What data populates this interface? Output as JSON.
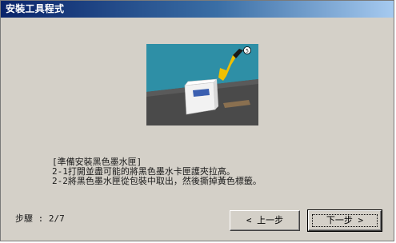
{
  "window": {
    "title": "安裝工具程式"
  },
  "illustration": {
    "icon": "ink-cartridge-illustration",
    "tape_badge": "5"
  },
  "instructions": {
    "lines": [
      "[準備安裝黑色墨水匣]",
      "2-1打開並盡可能的將黑色墨水卡匣護夾拉高。",
      "2-2將黑色墨水匣從包裝中取出，然後撕掉黃色標籤。"
    ]
  },
  "footer": {
    "step_label": "步驟 : 2/7",
    "back_label": "< 上一步",
    "next_label": "下一步 >"
  }
}
